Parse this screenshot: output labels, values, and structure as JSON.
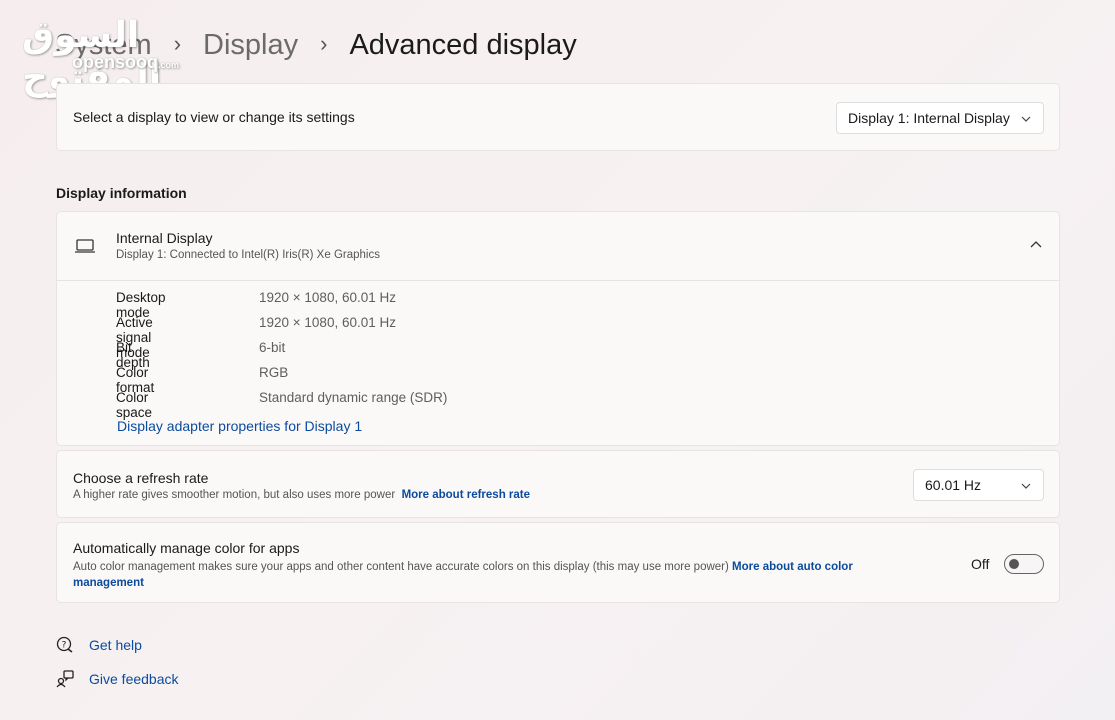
{
  "breadcrumb": {
    "root": "System",
    "parent": "Display",
    "current": "Advanced display",
    "separator": "›"
  },
  "watermark": {
    "arabic": "السوق المفتوح",
    "latin": "opensooq",
    "suffix": ".com"
  },
  "display_select": {
    "label": "Select a display to view or change its settings",
    "value": "Display 1: Internal Display"
  },
  "section_title": "Display information",
  "display_info": {
    "name": "Internal Display",
    "subtitle": "Display 1: Connected to Intel(R) Iris(R) Xe Graphics",
    "rows": [
      {
        "key": "Desktop mode",
        "value": "1920 × 1080, 60.01 Hz"
      },
      {
        "key": "Active signal mode",
        "value": "1920 × 1080, 60.01 Hz"
      },
      {
        "key": "Bit depth",
        "value": "6-bit"
      },
      {
        "key": "Color format",
        "value": "RGB"
      },
      {
        "key": "Color space",
        "value": "Standard dynamic range (SDR)"
      }
    ],
    "adapter_link": "Display adapter properties for Display 1"
  },
  "refresh_rate": {
    "title": "Choose a refresh rate",
    "description": "A higher rate gives smoother motion, but also uses more power",
    "link": "More about refresh rate",
    "value": "60.01 Hz"
  },
  "color_management": {
    "title": "Automatically manage color for apps",
    "description": "Auto color management makes sure your apps and other content have accurate colors on this display (this may use more power)",
    "link_part1": "More about auto color",
    "link_part2": "management",
    "toggle_label": "Off",
    "enabled": false
  },
  "help_links": {
    "get_help": "Get help",
    "give_feedback": "Give feedback"
  },
  "icons": [
    "monitor-icon",
    "chevron-up-icon",
    "chevron-down-icon",
    "help-icon",
    "feedback-icon"
  ],
  "colors": {
    "link": "#0a4b9e",
    "card_bg": "#fbf8f8"
  }
}
